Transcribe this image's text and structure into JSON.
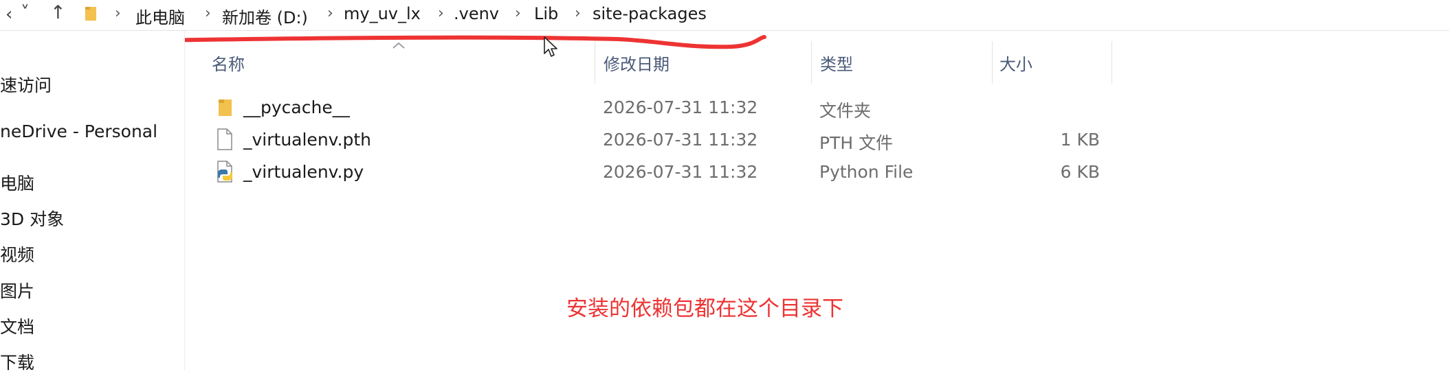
{
  "window": {
    "nav_buttons": [
      {
        "name": "back",
        "glyph": "‹"
      },
      {
        "name": "recent-dropdown",
        "glyph": "˅"
      },
      {
        "name": "up",
        "glyph": "↑"
      }
    ]
  },
  "breadcrumb": {
    "items": [
      "此电脑",
      "新加卷 (D:)",
      "my_uv_lx",
      ".venv",
      "Lib",
      "site-packages"
    ],
    "separator": "›"
  },
  "nav_pane": {
    "items": [
      {
        "label": "速访问",
        "icon": "star-icon"
      },
      {
        "label": "neDrive - Personal",
        "icon": "cloud-icon"
      },
      {
        "label": "电脑",
        "icon": "computer-icon"
      },
      {
        "label": "3D 对象",
        "icon": "cube-icon"
      },
      {
        "label": "视频",
        "icon": "video-icon"
      },
      {
        "label": "图片",
        "icon": "picture-icon"
      },
      {
        "label": "文档",
        "icon": "document-icon"
      },
      {
        "label": "下载",
        "icon": "download-icon"
      }
    ]
  },
  "columns": {
    "name": "名称",
    "modified": "修改日期",
    "type": "类型",
    "size": "大小"
  },
  "files": [
    {
      "name": "__pycache__",
      "modified": "2026-07-31 11:32",
      "type": "文件夹",
      "size": "",
      "icon": "folder-icon"
    },
    {
      "name": "_virtualenv.pth",
      "modified": "2026-07-31 11:32",
      "type": "PTH 文件",
      "size": "1 KB",
      "icon": "blank-file-icon"
    },
    {
      "name": "_virtualenv.py",
      "modified": "2026-07-31 11:32",
      "type": "Python File",
      "size": "6 KB",
      "icon": "python-file-icon"
    }
  ],
  "annotation": {
    "text": "安装的依赖包都在这个目录下",
    "color": "#ee3333"
  },
  "colors": {
    "folder": "#f2c14e",
    "annotation_red": "#ee3333"
  }
}
